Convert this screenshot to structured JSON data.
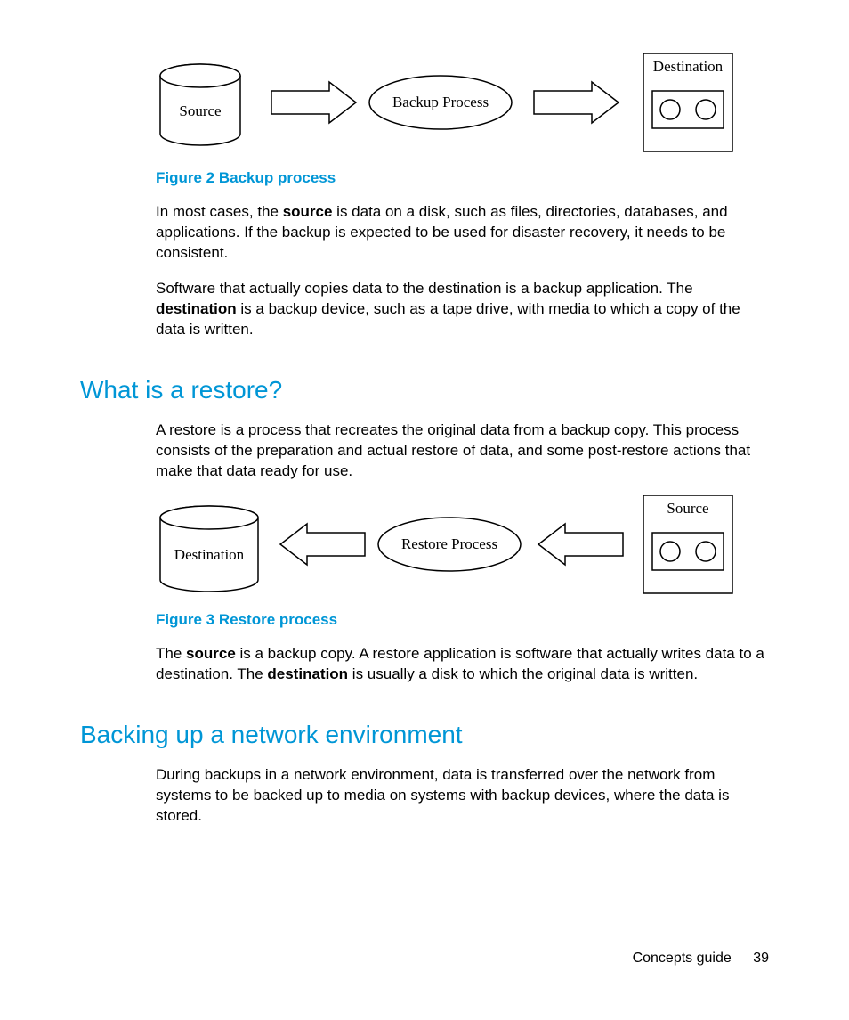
{
  "diagram1": {
    "source_label": "Source",
    "process_label": "Backup Process",
    "destination_label": "Destination"
  },
  "figure2_caption": "Figure 2 Backup process",
  "para1_a": "In most cases, the ",
  "para1_b": "source",
  "para1_c": " is data on a disk, such as files, directories, databases, and applications. If the backup is expected to be used for disaster recovery, it needs to be consistent.",
  "para2_a": "Software that actually copies data to the destination is a backup application. The ",
  "para2_b": "destination",
  "para2_c": " is a backup device, such as a tape drive, with media to which a copy of the data is written.",
  "heading1": "What is a restore?",
  "para3": "A restore is a process that recreates the original data from a backup copy. This process consists of the preparation and actual restore of data, and some post-restore actions that make that data ready for use.",
  "diagram2": {
    "destination_label": "Destination",
    "process_label": "Restore Process",
    "source_label": "Source"
  },
  "figure3_caption": "Figure 3 Restore process",
  "para4_a": "The ",
  "para4_b": "source",
  "para4_c": " is a backup copy. A restore application is software that actually writes data to a destination. The ",
  "para4_d": "destination",
  "para4_e": " is usually a disk to which the original data is written.",
  "heading2": "Backing up a network environment",
  "para5": "During backups in a network environment, data is transferred over the network from systems to be backed up to media on systems with backup devices, where the data is stored.",
  "footer_label": "Concepts guide",
  "page_number": "39"
}
